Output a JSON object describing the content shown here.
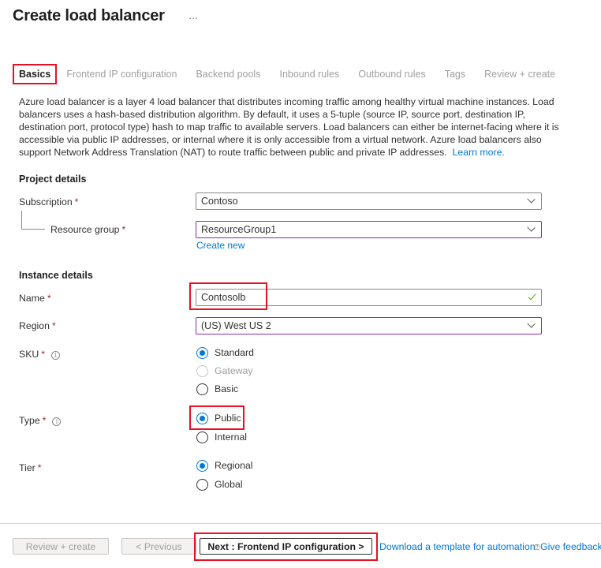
{
  "header": {
    "title": "Create load balancer",
    "more_icon": "…"
  },
  "tabs": [
    {
      "label": "Basics",
      "active": true
    },
    {
      "label": "Frontend IP configuration",
      "active": false
    },
    {
      "label": "Backend pools",
      "active": false
    },
    {
      "label": "Inbound rules",
      "active": false
    },
    {
      "label": "Outbound rules",
      "active": false
    },
    {
      "label": "Tags",
      "active": false
    },
    {
      "label": "Review + create",
      "active": false
    }
  ],
  "description": {
    "text": "Azure load balancer is a layer 4 load balancer that distributes incoming traffic among healthy virtual machine instances. Load balancers uses a hash-based distribution algorithm. By default, it uses a 5-tuple (source IP, source port, destination IP, destination port, protocol type) hash to map traffic to available servers. Load balancers can either be internet-facing where it is accessible via public IP addresses, or internal where it is only accessible from a virtual network. Azure load balancers also support Network Address Translation (NAT) to route traffic between public and private IP addresses.",
    "learn_more": "Learn more."
  },
  "project_details": {
    "heading": "Project details",
    "subscription": {
      "label": "Subscription",
      "required": "*",
      "value": "Contoso"
    },
    "resource_group": {
      "label": "Resource group",
      "required": "*",
      "value": "ResourceGroup1",
      "create_new": "Create new"
    }
  },
  "instance_details": {
    "heading": "Instance details",
    "name": {
      "label": "Name",
      "required": "*",
      "value": "Contosolb",
      "valid": true
    },
    "region": {
      "label": "Region",
      "required": "*",
      "value": "(US) West US 2"
    },
    "sku": {
      "label": "SKU",
      "required": "*",
      "info": "i",
      "options": [
        {
          "label": "Standard",
          "checked": true,
          "disabled": false
        },
        {
          "label": "Gateway",
          "checked": false,
          "disabled": true
        },
        {
          "label": "Basic",
          "checked": false,
          "disabled": false
        }
      ]
    },
    "type": {
      "label": "Type",
      "required": "*",
      "info": "i",
      "options": [
        {
          "label": "Public",
          "checked": true,
          "disabled": false
        },
        {
          "label": "Internal",
          "checked": false,
          "disabled": false
        }
      ]
    },
    "tier": {
      "label": "Tier",
      "required": "*",
      "options": [
        {
          "label": "Regional",
          "checked": true,
          "disabled": false
        },
        {
          "label": "Global",
          "checked": false,
          "disabled": false
        }
      ]
    }
  },
  "footer": {
    "review_create": "Review + create",
    "previous": "< Previous",
    "next": "Next : Frontend IP configuration >",
    "download_template": "Download a template for automation",
    "give_feedback": "Give feedback",
    "feedback_icon": "⍰"
  },
  "colors": {
    "accent": "#0078d4",
    "highlight": "#e81123",
    "focus_border": "#8a2da5",
    "required": "#a4262c",
    "valid": "#57a300"
  }
}
